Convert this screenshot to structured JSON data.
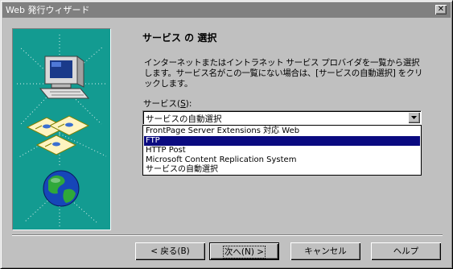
{
  "window": {
    "title": "Web 発行ウィザード",
    "close_glyph": "✕"
  },
  "colors": {
    "title_bar": "#808080",
    "panel_teal": "#139b91",
    "selection": "#0a0a80"
  },
  "side_panel": {
    "icons": [
      "computer-icon",
      "documents-icon",
      "globe-icon"
    ]
  },
  "page": {
    "heading": "サービス の 選択",
    "description": "インターネットまたはイントラネット サービス プロバイダを一覧から選択します。サービス名がこの一覧にない場合は、[サービスの自動選択] をクリックします。",
    "service_label_prefix": "サービス(",
    "service_label_hotkey": "S",
    "service_label_suffix": "):",
    "service_combo_value": "サービスの自動選択"
  },
  "dropdown": {
    "items": [
      "FrontPage Server Extensions 対応 Web",
      "FTP",
      "HTTP Post",
      "Microsoft Content Replication System",
      "サービスの自動選択"
    ],
    "selected_index": 1
  },
  "buttons": {
    "back": "< 戻る(B)",
    "next": "次へ(N) >",
    "cancel": "キャンセル",
    "help": "ヘルプ"
  }
}
